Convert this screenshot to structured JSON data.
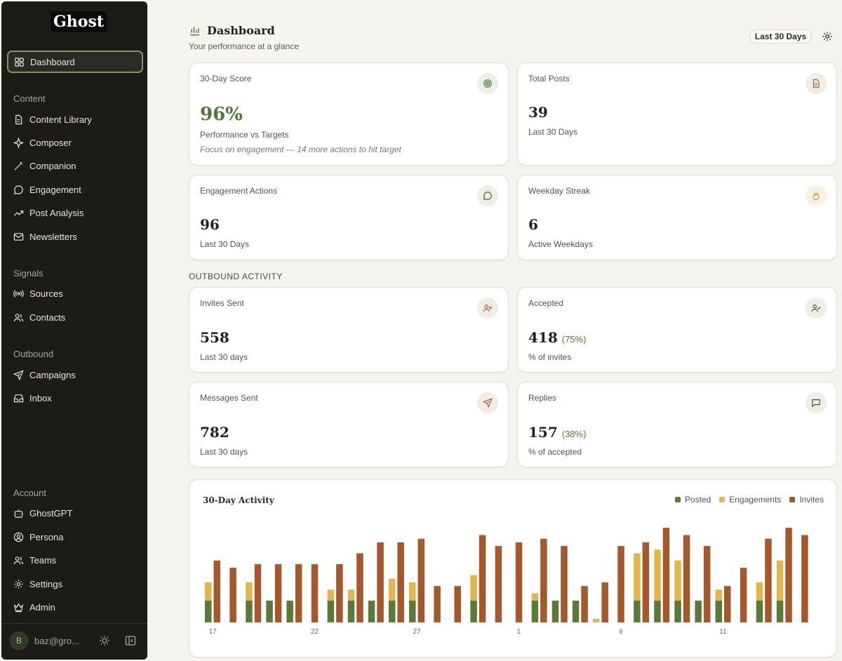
{
  "app": {
    "logo": "Ghost"
  },
  "sidebar": {
    "dashboard": "Dashboard",
    "groups": {
      "content": "Content",
      "signals": "Signals",
      "outbound": "Outbound",
      "account": "Account"
    },
    "items": {
      "content_library": "Content Library",
      "composer": "Composer",
      "companion": "Companion",
      "engagement": "Engagement",
      "post_analysis": "Post Analysis",
      "newsletters": "Newsletters",
      "sources": "Sources",
      "contacts": "Contacts",
      "campaigns": "Campaigns",
      "inbox": "Inbox",
      "ghostgpt": "GhostGPT",
      "persona": "Persona",
      "teams": "Teams",
      "settings": "Settings",
      "admin": "Admin"
    },
    "user": {
      "initial": "B",
      "email": "baz@gro..."
    }
  },
  "header": {
    "title": "Dashboard",
    "subtitle": "Your performance at a glance",
    "range": "Last 30 Days"
  },
  "cards": {
    "score": {
      "label": "30-Day Score",
      "value": "96%",
      "sub": "Performance vs Targets",
      "note": "Focus on engagement — 14 more actions to hit target"
    },
    "posts": {
      "label": "Total Posts",
      "value": "39",
      "sub": "Last 30 Days"
    },
    "engagement": {
      "label": "Engagement Actions",
      "value": "96",
      "sub": "Last 30 Days"
    },
    "streak": {
      "label": "Weekday Streak",
      "value": "6",
      "sub": "Active Weekdays"
    },
    "invites": {
      "label": "Invites Sent",
      "value": "558",
      "sub": "Last 30 days"
    },
    "accepted": {
      "label": "Accepted",
      "value": "418",
      "pct": "(75%)",
      "sub": "% of invites"
    },
    "messages": {
      "label": "Messages Sent",
      "value": "782",
      "sub": "Last 30 days"
    },
    "replies": {
      "label": "Replies",
      "value": "157",
      "pct": "(38%)",
      "sub": "% of accepted"
    }
  },
  "outbound_label": "OUTBOUND ACTIVITY",
  "colors": {
    "posted": "#5b7a3a",
    "engagements": "#e3b54d",
    "invites": "#a5582b",
    "accent_green": "#4f7a33"
  },
  "icons": {
    "score": "target-icon",
    "posts": "document-icon",
    "engagement": "chat-bubble-icon",
    "streak": "flame-icon",
    "invites": "user-plus-icon",
    "accepted": "user-check-icon",
    "messages": "send-icon",
    "replies": "message-square-icon"
  },
  "chart_data": {
    "type": "bar",
    "title": "30-Day Activity",
    "stacked_series": [
      "Posted",
      "Engagements"
    ],
    "grouped_series": [
      "Invites"
    ],
    "legend_position": "top-right",
    "x": [
      17,
      18,
      19,
      20,
      21,
      22,
      23,
      24,
      25,
      26,
      27,
      28,
      29,
      30,
      31,
      1,
      2,
      3,
      4,
      5,
      6,
      7,
      8,
      9,
      10,
      11,
      12,
      13,
      14,
      15
    ],
    "x_tick_labels": [
      "17",
      "22",
      "27",
      "1",
      "6",
      "11"
    ],
    "series": [
      {
        "name": "Posted",
        "values": [
          6,
          0,
          6,
          6,
          6,
          0,
          6,
          6,
          6,
          6,
          6,
          0,
          0,
          6,
          0,
          0,
          6,
          6,
          6,
          0,
          0,
          6,
          6,
          6,
          6,
          6,
          0,
          6,
          6,
          0
        ]
      },
      {
        "name": "Engagements",
        "values": [
          5,
          0,
          5,
          0,
          0,
          0,
          3,
          3,
          0,
          6,
          5,
          0,
          0,
          7,
          0,
          0,
          2,
          0,
          0,
          1,
          0,
          13,
          14,
          11,
          0,
          3,
          0,
          5,
          11,
          0
        ]
      },
      {
        "name": "Invites",
        "values": [
          17,
          15,
          16,
          16,
          16,
          16,
          16,
          19,
          22,
          22,
          23,
          10,
          10,
          24,
          21,
          22,
          23,
          21,
          10,
          11,
          21,
          22,
          26,
          24,
          21,
          10,
          15,
          23,
          26,
          24
        ]
      }
    ],
    "ylim": [
      0,
      27
    ],
    "grid": false
  }
}
